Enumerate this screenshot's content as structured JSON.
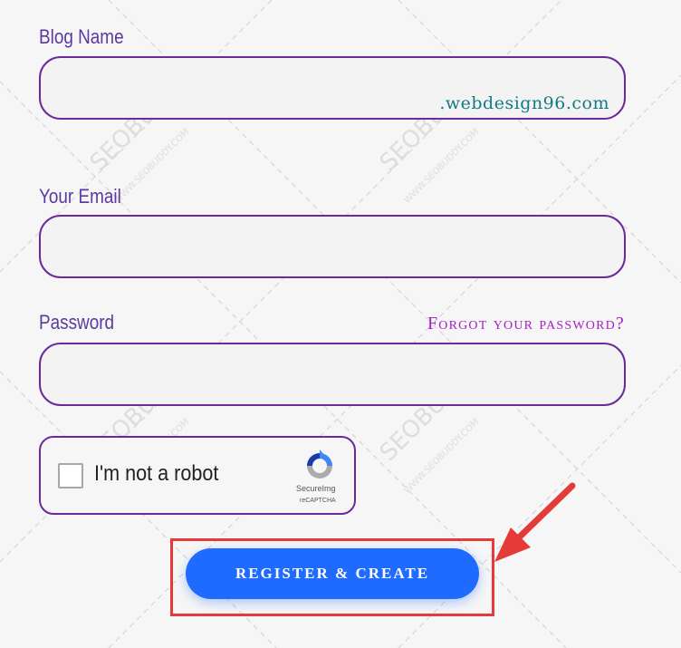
{
  "form": {
    "blog_name": {
      "label": "Blog Name",
      "value": "",
      "suffix": ".webdesign96.com"
    },
    "email": {
      "label": "Your Email",
      "value": ""
    },
    "password": {
      "label": "Password",
      "value": "",
      "forgot_link": "Forgot your password?"
    },
    "captcha": {
      "label": "I'm not a robot",
      "brand": "SecureImg",
      "brand_sub": "reCAPTCHA",
      "checked": false
    },
    "submit_label": "REGISTER & CREATE"
  },
  "watermark": {
    "text": "SEOBUDDY",
    "subtext": "WWW.SEOBUDDY.COM"
  },
  "colors": {
    "label": "#5b3aa0",
    "field_border": "#6a2a9a",
    "suffix": "#137a86",
    "forgot_link": "#a51fc4",
    "button": "#1f6bff",
    "highlight": "#e53a3a"
  }
}
